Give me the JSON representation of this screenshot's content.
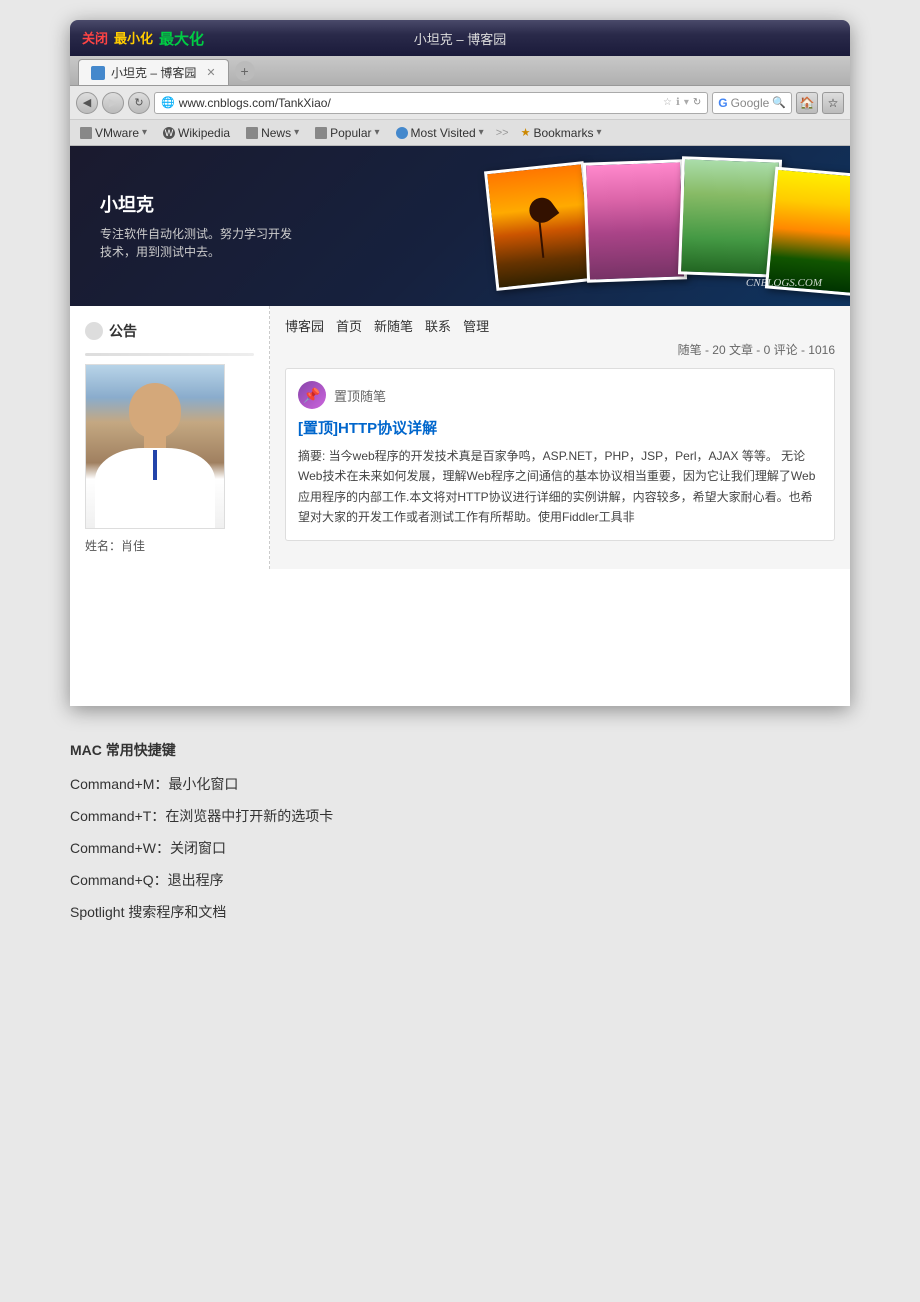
{
  "browser": {
    "title": "小坦克 – 博客园",
    "close_label": "关闭",
    "min_label": "最小化",
    "max_label": "最大化",
    "tab_title": "小坦克 – 博客园",
    "url": "www.cnblogs.com/TankXiao/",
    "search_engine": "Google",
    "search_placeholder": "Google",
    "nav_buttons": [
      "◀",
      "▶",
      "↻"
    ],
    "bookmarks": [
      {
        "label": "VMware",
        "dropdown": true
      },
      {
        "label": "Wikipedia",
        "dropdown": false
      },
      {
        "label": "News",
        "dropdown": true
      },
      {
        "label": "Popular",
        "dropdown": true
      },
      {
        "label": "Most Visited",
        "dropdown": true
      },
      {
        "label": "Bookmarks",
        "dropdown": true
      }
    ],
    "bookmarks_overflow": "»"
  },
  "blog": {
    "name": "小坦克",
    "description": "专注软件自动化测试。努力学习开发技术，用到测试中去。",
    "watermark": "CNBLOGS.COM",
    "nav_items": [
      "博客园",
      "首页",
      "新随笔",
      "联系",
      "管理"
    ],
    "stats": "随笔 - 20  文章 - 0  评论 - 1016",
    "sidebar": {
      "section_title": "公告",
      "name_label": "姓名：肖佳"
    },
    "post": {
      "type_label": "置顶随笔",
      "title": "[置顶]HTTP协议详解",
      "excerpt": "摘要: 当今web程序的开发技术真是百家争鸣，ASP.NET，PHP，JSP，Perl，AJAX 等等。 无论Web技术在未来如何发展，理解Web程序之间通信的基本协议相当重要，因为它让我们理解了Web应用程序的内部工作.本文将对HTTP协议进行详细的实例讲解，内容较多，希望大家耐心看。也希望对大家的开发工作或者测试工作有所帮助。使用Fiddler工具非"
    }
  },
  "mac_shortcuts": {
    "title": "MAC 常用快捷键",
    "shortcuts": [
      {
        "keys": "Command+M：",
        "desc": "最小化窗口"
      },
      {
        "keys": "Command+T：",
        "desc": "在浏览器中打开新的选项卡"
      },
      {
        "keys": "Command+W：",
        "desc": "关闭窗口"
      },
      {
        "keys": "Command+Q：",
        "desc": "退出程序"
      },
      {
        "keys": "Spotlight",
        "desc": "搜索程序和文档"
      }
    ]
  },
  "window_controls": {
    "close": "关闭",
    "minimize": "最小化",
    "maximize": "最大化"
  }
}
